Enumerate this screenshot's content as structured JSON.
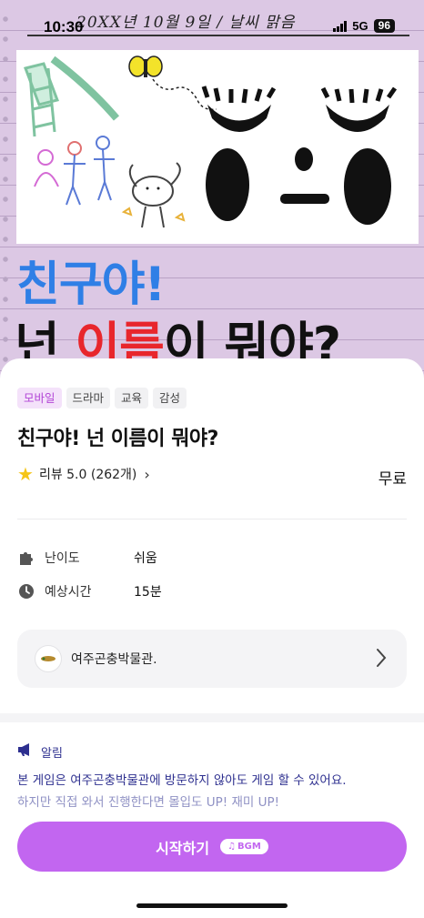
{
  "status_bar": {
    "time": "10:30",
    "network": "5G",
    "battery": "96"
  },
  "hero": {
    "handwritten_date": "20XX년 10월 9일 / 날씨 맑음",
    "title_line1": "친구야!",
    "title_line2_prefix": "넌 ",
    "title_line2_highlight": "이름",
    "title_line2_suffix": "이 뭐야?"
  },
  "game": {
    "tags": [
      "모바일",
      "드라마",
      "교육",
      "감성"
    ],
    "title": "친구야! 넌 이름이 뭐야?",
    "review_label": "리뷰 5.0 (262개)",
    "price": "무료",
    "difficulty_label": "난이도",
    "difficulty_value": "쉬움",
    "time_label": "예상시간",
    "time_value": "15분",
    "organization": "여주곤충박물관."
  },
  "notice": {
    "heading": "알림",
    "line1": "본 게임은 여주곤충박물관에 방문하지 않아도 게임 할 수 있어요.",
    "line2": "하지만 직접 와서 진행한다면 몰입도 UP! 재미 UP!"
  },
  "start_button": {
    "label": "시작하기",
    "bgm_badge": "BGM"
  },
  "colors": {
    "accent": "#c266f0",
    "tag_accent": "#b245d6",
    "notice": "#2d2f8f",
    "title_blue": "#2f7fe6",
    "title_red": "#e8262c"
  }
}
